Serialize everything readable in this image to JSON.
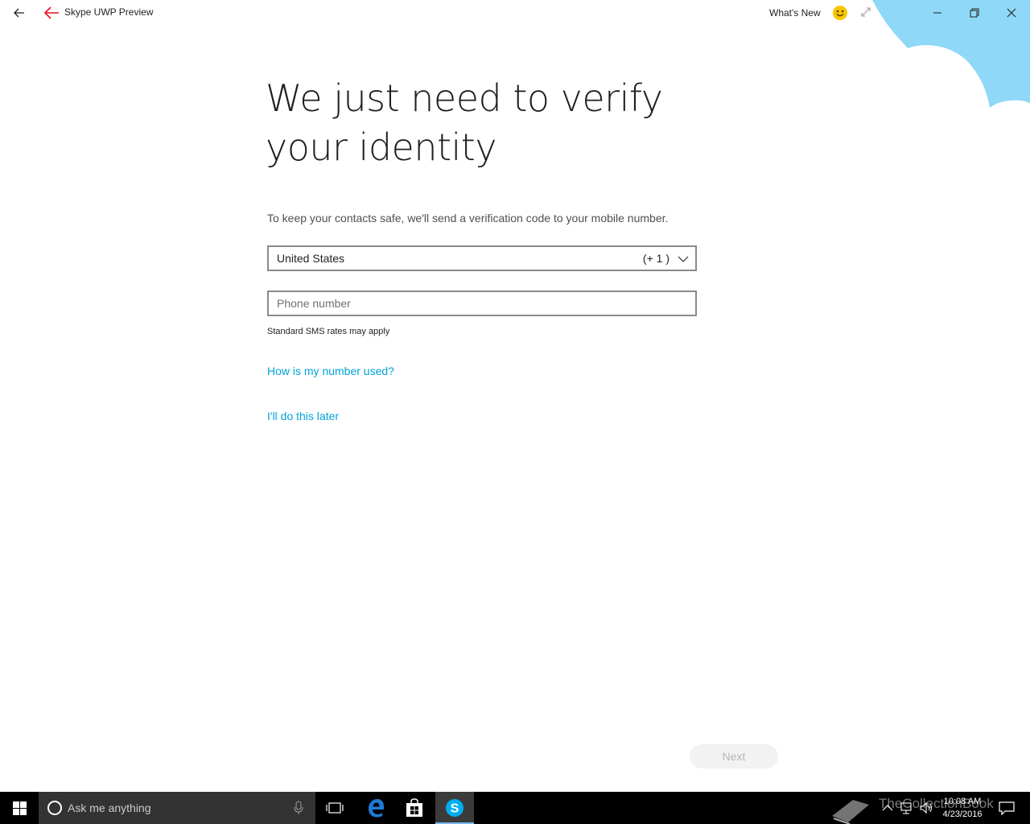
{
  "titlebar": {
    "app_title": "Skype UWP Preview",
    "whats_new": "What's New"
  },
  "main": {
    "heading": "We just need to verify your identity",
    "description": "To keep your contacts safe, we'll send a verification code to your mobile number.",
    "country": {
      "name": "United States",
      "code": "(+ 1 )"
    },
    "phone": {
      "placeholder": "Phone number",
      "value": ""
    },
    "sms_note": "Standard SMS rates may apply",
    "link_how": "How is my number used?",
    "link_later": "I'll do this later",
    "next_label": "Next"
  },
  "colors": {
    "accent": "#00a3d9",
    "cloud": "#8fd8f7"
  },
  "taskbar": {
    "search_placeholder": "Ask me anything",
    "watermark": "TheCollectionBook",
    "time": "10:08 AM",
    "date": "4/23/2016"
  }
}
